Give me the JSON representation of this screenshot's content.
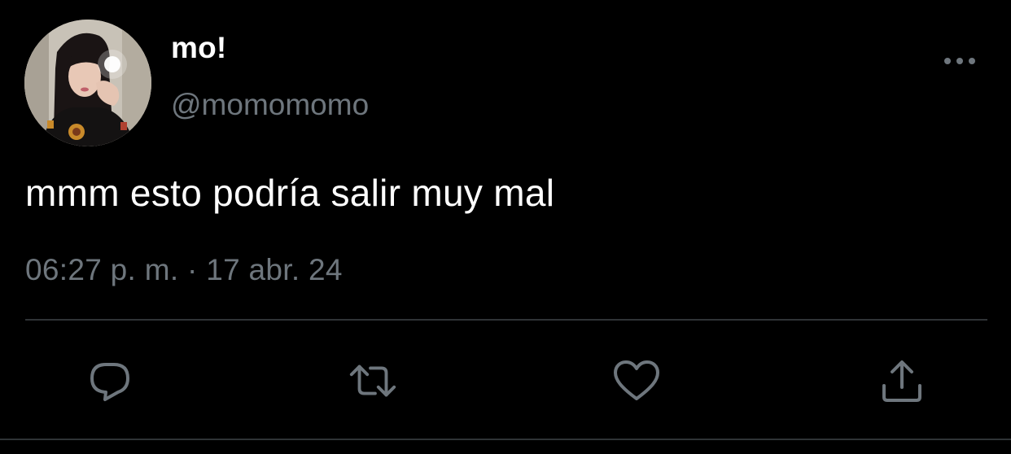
{
  "tweet": {
    "display_name": "mo!",
    "handle": "@momomomo",
    "text": "mmm esto podría salir muy mal",
    "timestamp": "06:27 p. m. · 17 abr. 24"
  },
  "icons": {
    "avatar": "profile-photo",
    "more": "more-dots-icon",
    "reply": "reply-icon",
    "retweet": "retweet-icon",
    "like": "heart-icon",
    "share": "share-icon"
  },
  "colors": {
    "background": "#000000",
    "text_primary": "#ffffff",
    "text_secondary": "#6e767d",
    "divider": "#2f3336",
    "icon": "#6e767d"
  }
}
